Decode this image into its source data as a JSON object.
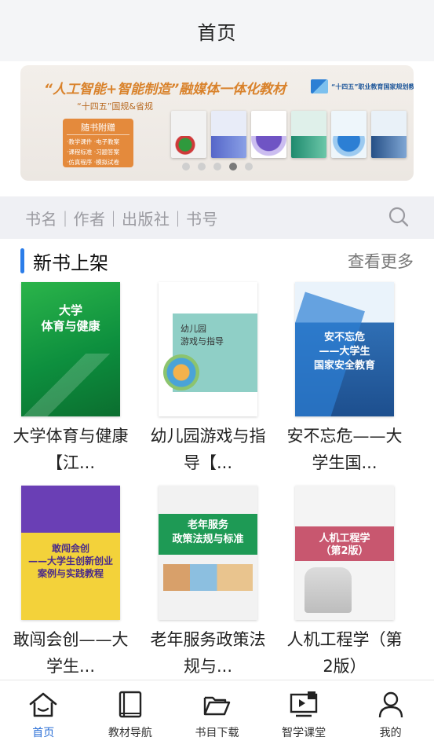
{
  "header": {
    "title": "首页"
  },
  "banner": {
    "headline": "“人工智能+智能制造”融媒体一体化教材",
    "sub": "“十四五”国规&省规",
    "brand": "“十四五”职业教育国家规划教材",
    "box_title": "随书附赠",
    "box_lines": [
      "·教学课件 ·电子教案",
      "·课程标准 ·习题答案",
      "·仿真程序 ·模拟试卷"
    ],
    "active_dot": 4
  },
  "search": {
    "placeholder": "书名｜作者｜出版社｜书号",
    "icon": "search-icon"
  },
  "section": {
    "title": "新书上架",
    "more": "查看更多"
  },
  "books": [
    {
      "title": "大学体育与健康【江...",
      "cover_text": "大学\n体育与健康"
    },
    {
      "title": "幼儿园游戏与指导【...",
      "cover_text": "幼儿园\n游戏与指导"
    },
    {
      "title": "安不忘危——大学生国...",
      "cover_text": "安不忘危\n——大学生\n国家安全教育"
    },
    {
      "title": "敢闯会创——大学生...",
      "cover_text": "敢闯会创\n——大学生创新创业\n案例与实践教程"
    },
    {
      "title": "老年服务政策法规与...",
      "cover_text": "老年服务\n政策法规与标准"
    },
    {
      "title": "人机工程学（第2版）",
      "cover_text": "人机工程学\n（第2版）"
    }
  ],
  "tabbar": {
    "active": 0,
    "tabs": [
      {
        "label": "首页",
        "icon": "home-icon"
      },
      {
        "label": "教材导航",
        "icon": "book-icon"
      },
      {
        "label": "书目下载",
        "icon": "folder-icon"
      },
      {
        "label": "智学课堂",
        "icon": "classroom-icon"
      },
      {
        "label": "我的",
        "icon": "user-icon"
      }
    ]
  },
  "colors": {
    "accent": "#2b6fd6",
    "section_bar": "#2b7de9",
    "banner_orange": "#d9822b"
  }
}
